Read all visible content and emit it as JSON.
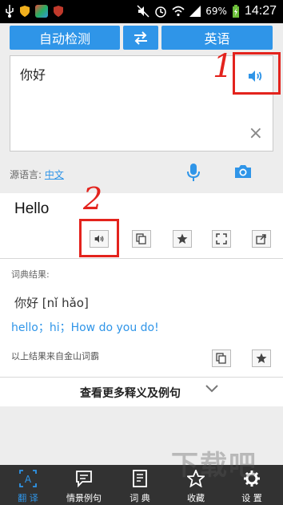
{
  "status_bar": {
    "battery": "69%",
    "time": "14:27"
  },
  "lang_bar": {
    "source_lang_btn": "自动检测",
    "target_lang_btn": "英语",
    "swap_icon": "swap-arrows-icon"
  },
  "input": {
    "text": "你好",
    "clear_icon": "×",
    "source_label": "源语言:",
    "source_value": "中文"
  },
  "annotations": {
    "one": "1",
    "two": "2"
  },
  "result": {
    "word": "Hello"
  },
  "dictionary": {
    "label": "词典结果:",
    "entry": "你好 [nǐ hǎo]",
    "meanings": "hello；hi；How do you do!",
    "source_note": "以上结果来自金山词霸"
  },
  "more": {
    "label": "查看更多释义及例句"
  },
  "tabs": [
    {
      "label": "翻 译",
      "icon": "translate-icon"
    },
    {
      "label": "情景例句",
      "icon": "sentences-icon"
    },
    {
      "label": "词 典",
      "icon": "dictionary-icon"
    },
    {
      "label": "收藏",
      "icon": "star-icon"
    },
    {
      "label": "设 置",
      "icon": "gear-icon"
    }
  ],
  "watermark": "下载吧",
  "colors": {
    "accent": "#2f95e8",
    "annotation": "#e3231d",
    "bottom_bar": "#323232"
  }
}
